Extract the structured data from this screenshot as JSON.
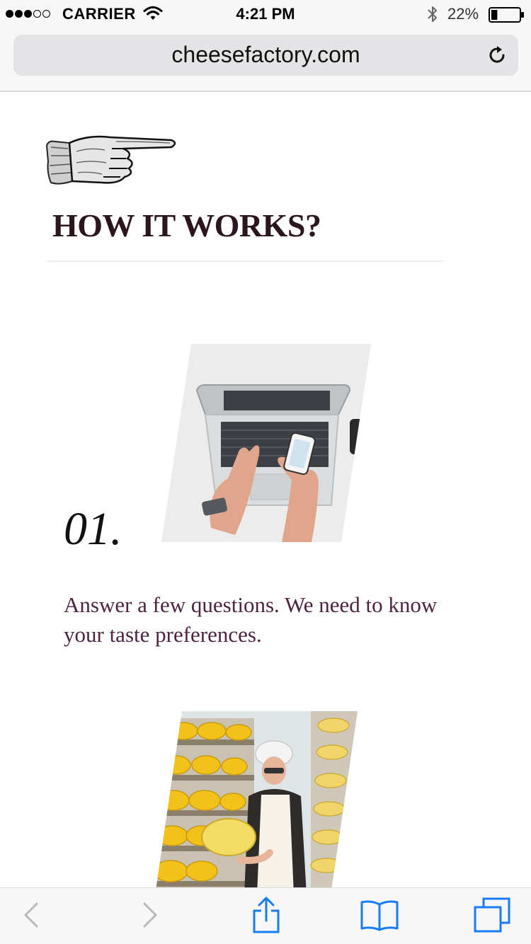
{
  "status_bar": {
    "signal_strength": 3,
    "signal_max": 5,
    "carrier": "CARRIER",
    "time": "4:21 PM",
    "battery_percent": "22%",
    "battery_level": 0.22,
    "icons": [
      "wifi-icon",
      "bluetooth-icon",
      "battery-icon"
    ]
  },
  "browser": {
    "url": "cheesefactory.com",
    "icons": [
      "reload-icon"
    ]
  },
  "page": {
    "section_title": "HOW IT WORKS?",
    "steps": [
      {
        "number": "01.",
        "text": "Answer a few questions. We need to know your taste preferences."
      }
    ]
  },
  "toolbar": {
    "icons": [
      "back-icon",
      "forward-icon",
      "share-icon",
      "bookmarks-icon",
      "tabs-icon"
    ],
    "accent_color": "#1a7cf4",
    "disabled_color": "#b8b8b8"
  },
  "colors": {
    "title": "#2b1620",
    "step_text": "#4e2442"
  }
}
